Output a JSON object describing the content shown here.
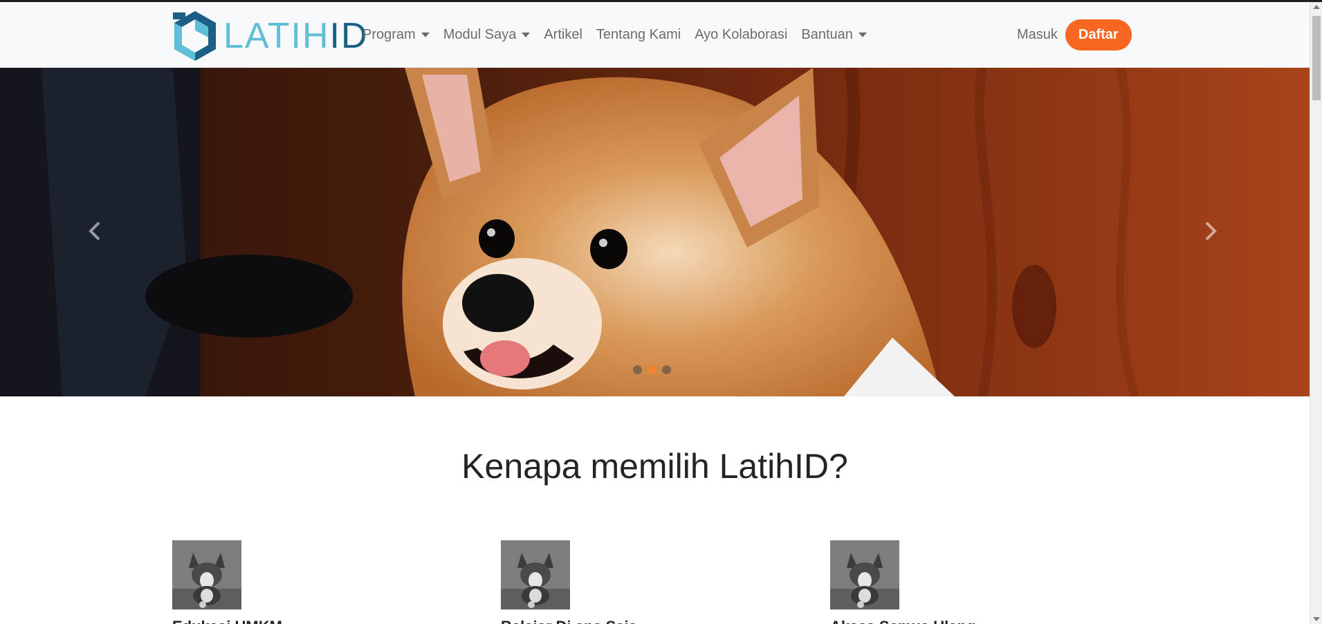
{
  "brand": {
    "name_main": "LATIH",
    "name_accent": "ID",
    "logo_icon": "latihid-hexagon-logo"
  },
  "nav": {
    "items": [
      {
        "label": "Program",
        "dropdown": true
      },
      {
        "label": "Modul Saya",
        "dropdown": true
      },
      {
        "label": "Artikel",
        "dropdown": false
      },
      {
        "label": "Tentang Kami",
        "dropdown": false
      },
      {
        "label": "Ayo Kolaborasi",
        "dropdown": false
      },
      {
        "label": "Bantuan",
        "dropdown": true
      }
    ],
    "login_label": "Masuk",
    "register_label": "Daftar"
  },
  "carousel": {
    "slide_image": "corgi-photo",
    "indicator_count": 3,
    "active_index": 1,
    "prev_icon": "chevron-left-icon",
    "next_icon": "chevron-right-icon"
  },
  "section": {
    "title": "Kenapa memilih LatihID?"
  },
  "features": [
    {
      "image": "corgi-thumbnail",
      "title": "Edukasi UMKM"
    },
    {
      "image": "corgi-thumbnail",
      "title": "Belajar Di ana Saja"
    },
    {
      "image": "corgi-thumbnail",
      "title": "Akses Semua Ulang"
    }
  ],
  "colors": {
    "accent_orange": "#f86622",
    "brand_light_blue": "#5fbfd8",
    "brand_dark_blue": "#1b5f86",
    "indicator_active": "#f1852d"
  }
}
